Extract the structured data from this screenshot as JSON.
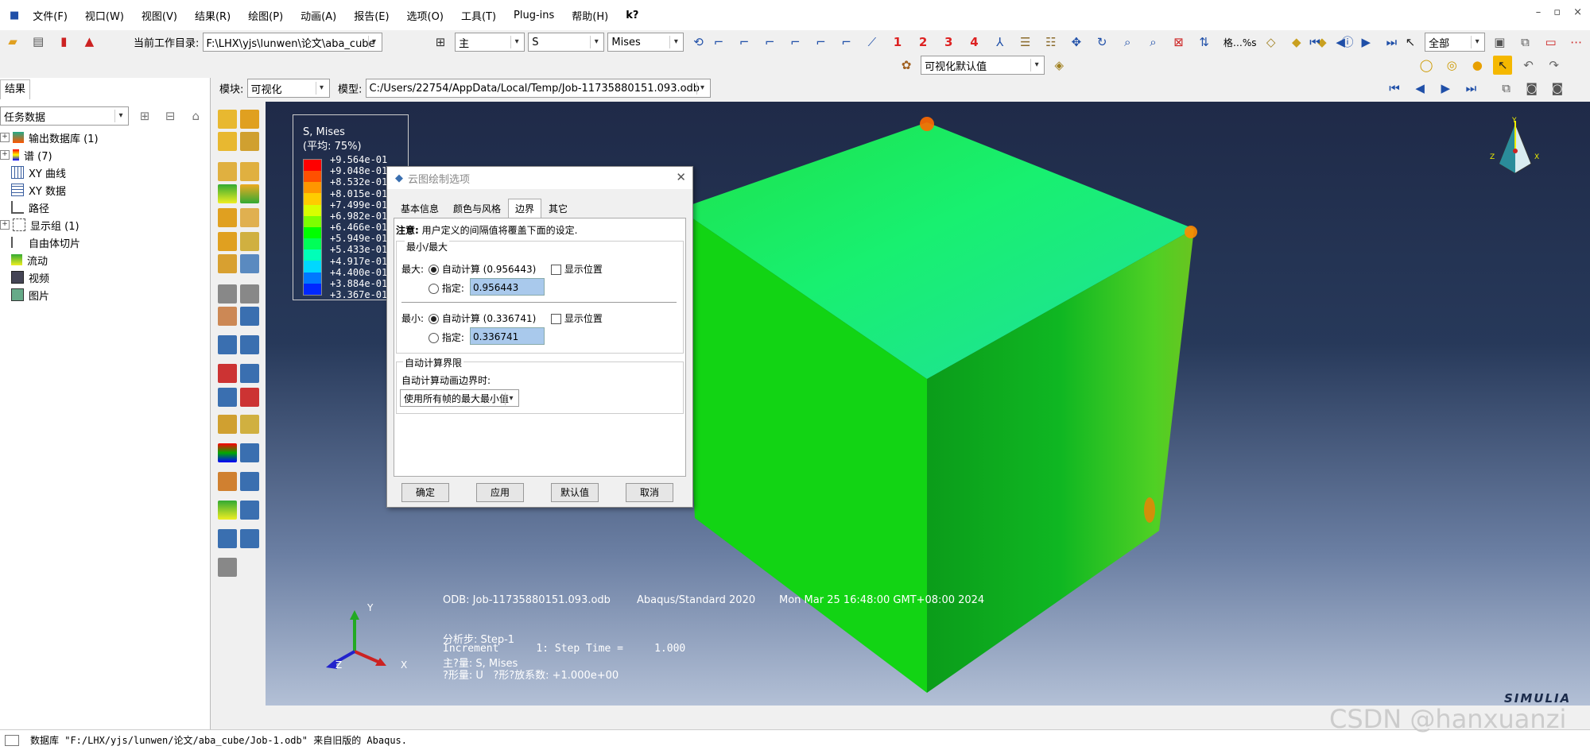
{
  "menu": [
    "文件(F)",
    "视口(W)",
    "视图(V)",
    "结果(R)",
    "绘图(P)",
    "动画(A)",
    "报告(E)",
    "选项(O)",
    "工具(T)",
    "Plug-ins",
    "帮助(H)",
    "k?"
  ],
  "window_controls": [
    "–",
    "▫",
    "×"
  ],
  "toolbar1": {
    "workdir_label": "当前工作目录:",
    "workdir_value": "F:\\LHX\\yjs\\lunwen\\论文\\aba_cube",
    "step_select": "主",
    "field_select": "S",
    "invariant_select": "Mises",
    "numbers": [
      "1",
      "2",
      "3",
      "4"
    ],
    "format_label": "格…%s",
    "filter_select": "全部"
  },
  "toolbar2": {
    "defaults_select": "可视化默认值"
  },
  "context": {
    "module_label": "模块:",
    "module_value": "可视化",
    "model_label": "模型:",
    "model_value": "C:/Users/22754/AppData/Local/Temp/Job-11735880151.093.odb"
  },
  "left_panel": {
    "tab": "结果",
    "filter": "任务数据",
    "tree": [
      {
        "label": "输出数据库 (1)",
        "expand": "+"
      },
      {
        "label": "谱 (7)",
        "expand": "+"
      },
      {
        "label": "XY 曲线",
        "expand": ""
      },
      {
        "label": "XY 数据",
        "expand": ""
      },
      {
        "label": "路径",
        "expand": ""
      },
      {
        "label": "显示组 (1)",
        "expand": "+"
      },
      {
        "label": "自由体切片",
        "expand": ""
      },
      {
        "label": "流动",
        "expand": ""
      },
      {
        "label": "视频",
        "expand": ""
      },
      {
        "label": "图片",
        "expand": ""
      }
    ]
  },
  "legend": {
    "title": "S, Mises",
    "subtitle": "(平均: 75%)",
    "values": [
      "+9.564e-01",
      "+9.048e-01",
      "+8.532e-01",
      "+8.015e-01",
      "+7.499e-01",
      "+6.982e-01",
      "+6.466e-01",
      "+5.949e-01",
      "+5.433e-01",
      "+4.917e-01",
      "+4.400e-01",
      "+3.884e-01",
      "+3.367e-01"
    ],
    "colors": [
      "#ff0000",
      "#ff5000",
      "#ff9600",
      "#ffcc00",
      "#d8ff00",
      "#7dff00",
      "#00ff00",
      "#00ff58",
      "#00ffb8",
      "#00d8ff",
      "#0078ff",
      "#0028ff",
      "#0000ff"
    ]
  },
  "dialog": {
    "title": "云图绘制选项",
    "tabs": [
      "基本信息",
      "颜色与风格",
      "边界",
      "其它"
    ],
    "active_tab": "边界",
    "note_label": "注意:",
    "note_text": "用户定义的间隔值将覆盖下面的设定.",
    "minmax_group": "最小/最大",
    "max_label": "最大:",
    "max_auto": "自动计算 (0.956443)",
    "show_location": "显示位置",
    "specify": "指定:",
    "max_value": "0.956443",
    "min_label": "最小:",
    "min_auto": "自动计算 (0.336741)",
    "min_value": "0.336741",
    "auto_group": "自动计算界限",
    "auto_anim_label": "自动计算动画边界时:",
    "auto_anim_value": "使用所有帧的最大最小值",
    "buttons": {
      "ok": "确定",
      "apply": "应用",
      "defaults": "默认值",
      "cancel": "取消"
    }
  },
  "viewport_info": {
    "odb": "ODB: Job-11735880151.093.odb",
    "solver": "Abaqus/Standard 2020",
    "date": "Mon Mar 25 16:48:00 GMT+08:00 2024",
    "step": "分析步: Step-1",
    "increment": "Increment      1: Step Time =     1.000",
    "primary": "主?量: S, Mises",
    "deformed": "?形量: U   ?形?放系数: +1.000e+00",
    "brand": "SIMULIA",
    "axes": {
      "y": "Y",
      "x": "X",
      "z": "Z"
    }
  },
  "status": {
    "message": "数据库 \"F:/LHX/yjs/lunwen/论文/aba_cube/Job-1.odb\" 来自旧版的 Abaqus."
  },
  "watermark": "CSDN @hanxuanzi"
}
